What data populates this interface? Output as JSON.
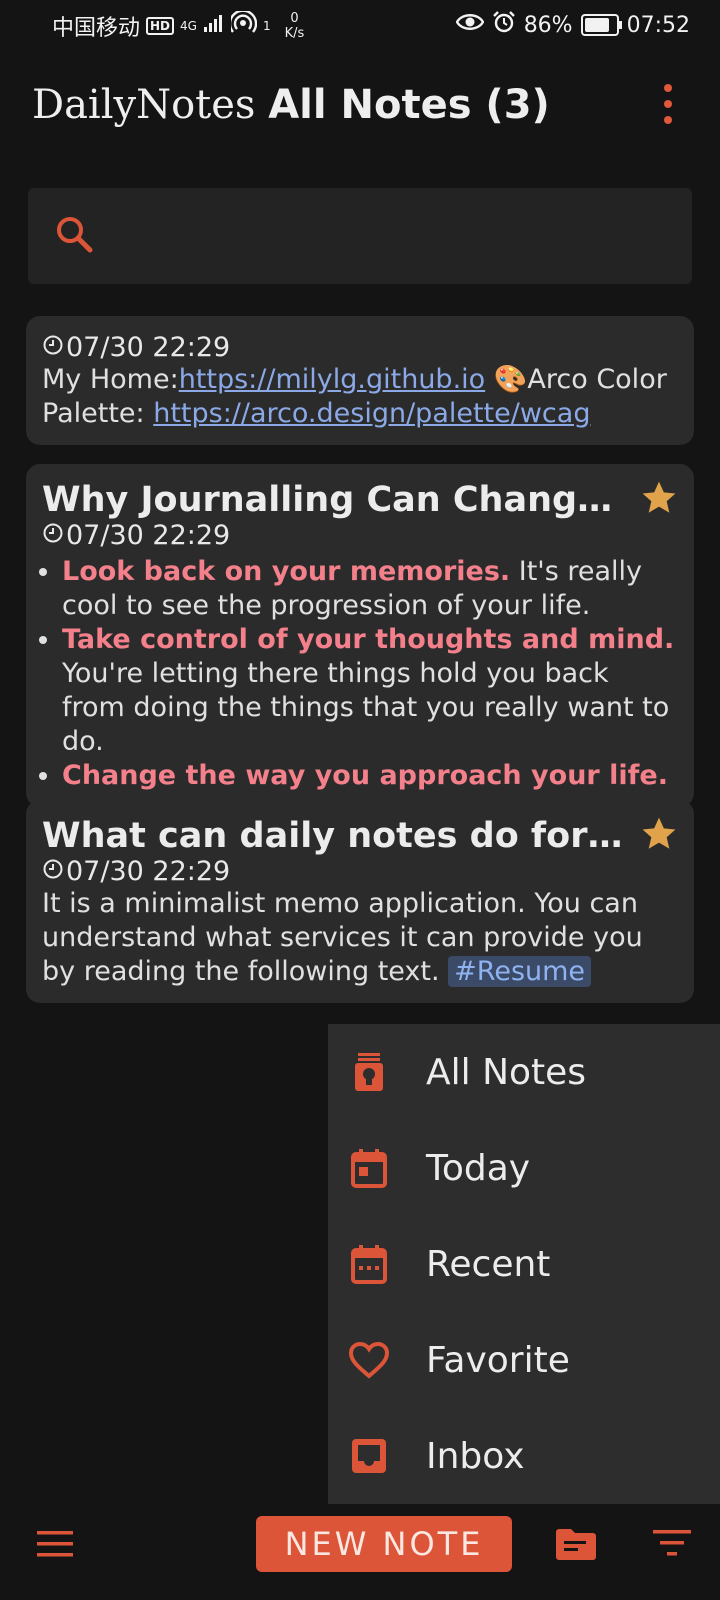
{
  "status_bar": {
    "carrier": "中国移动",
    "hd": "HD",
    "network": "4G",
    "hotspot_count": "1",
    "speed_value": "0",
    "speed_unit": "K/s",
    "battery": "86%",
    "battery_level_percent": 86,
    "time": "07:52"
  },
  "app_bar": {
    "brand": "DailyNotes",
    "view_title": "All Notes (3)",
    "more_icon": "more-vert-icon"
  },
  "search": {
    "placeholder": "",
    "value": "",
    "icon": "search-icon"
  },
  "notes": [
    {
      "time": "07/30 22:29",
      "home_label": "My Home:",
      "home_link": "https://milylg.github.io",
      "palette_emoji": "🎨",
      "palette_label": "Arco Color Palette: ",
      "palette_link": "https://arco.design/palette/wcag"
    },
    {
      "title": "Why Journalling Can Change Y...",
      "favorite": true,
      "time": "07/30 22:29",
      "bullets": [
        {
          "bold": "Look back on your memories.",
          "text": " It's really cool to see the progression of your life."
        },
        {
          "bold": "Take control of your thoughts and mind.",
          "text": " You're letting there things hold you back from doing the things that you really want to do."
        },
        {
          "bold": "Change the way you approach your life.",
          "text": ""
        }
      ]
    },
    {
      "title": "What can daily notes do for you?",
      "favorite": true,
      "time": "07/30 22:29",
      "text": "It is a minimalist memo application. You can understand what services it can provide you by reading the following text. ",
      "tag": "#Resume"
    }
  ],
  "menu": {
    "items": [
      {
        "label": "All Notes",
        "icon": "lightbulb-icon"
      },
      {
        "label": "Today",
        "icon": "calendar-today-icon"
      },
      {
        "label": "Recent",
        "icon": "calendar-recent-icon"
      },
      {
        "label": "Favorite",
        "icon": "heart-icon"
      },
      {
        "label": "Inbox",
        "icon": "inbox-icon"
      }
    ]
  },
  "bottom_bar": {
    "new_note_label": "NEW NOTE",
    "menu_icon": "hamburger-icon",
    "folder_icon": "folder-icon",
    "filter_icon": "filter-icon"
  },
  "colors": {
    "accent": "#DC5538",
    "background": "#141414",
    "card": "#2B2B2B",
    "link": "#8AA9E6",
    "highlight": "#F3808A",
    "star": "#E0A24A"
  }
}
